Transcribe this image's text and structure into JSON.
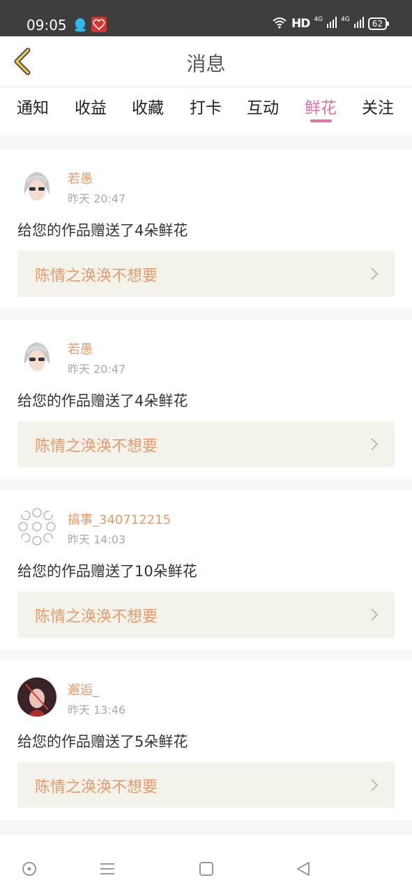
{
  "status_bar": {
    "time": "09:05",
    "hd": "HD",
    "net1": "4G",
    "net2": "4G",
    "battery": "62"
  },
  "header": {
    "title": "消息",
    "back_icon": "chevron-left-icon",
    "accent": "#e6c84a"
  },
  "tabs": [
    {
      "label": "通知",
      "active": false
    },
    {
      "label": "收益",
      "active": false
    },
    {
      "label": "收藏",
      "active": false
    },
    {
      "label": "打卡",
      "active": false
    },
    {
      "label": "互动",
      "active": false
    },
    {
      "label": "鲜花",
      "active": true
    },
    {
      "label": "关注",
      "active": false
    }
  ],
  "colors": {
    "active_tab": "#e66fa4",
    "username": "#e89a6a",
    "link_bg": "#f3f3ec"
  },
  "messages": [
    {
      "username": "若愚",
      "time": "昨天 20:47",
      "text": "给您的作品赠送了4朵鲜花",
      "work": "陈情之涣涣不想要",
      "avatar": "anime-avatar"
    },
    {
      "username": "若愚",
      "time": "昨天 20:47",
      "text": "给您的作品赠送了4朵鲜花",
      "work": "陈情之涣涣不想要",
      "avatar": "anime-avatar"
    },
    {
      "username": "搞事_340712215",
      "time": "昨天 14:03",
      "text": "给您的作品赠送了10朵鲜花",
      "work": "陈情之涣涣不想要",
      "avatar": "pattern-avatar"
    },
    {
      "username": "邂逅_",
      "time": "昨天 13:46",
      "text": "给您的作品赠送了5朵鲜花",
      "work": "陈情之涣涣不想要",
      "avatar": "photo-avatar"
    }
  ],
  "bottom_nav": [
    "circle-icon",
    "menu-icon",
    "square-icon",
    "triangle-back-icon"
  ]
}
